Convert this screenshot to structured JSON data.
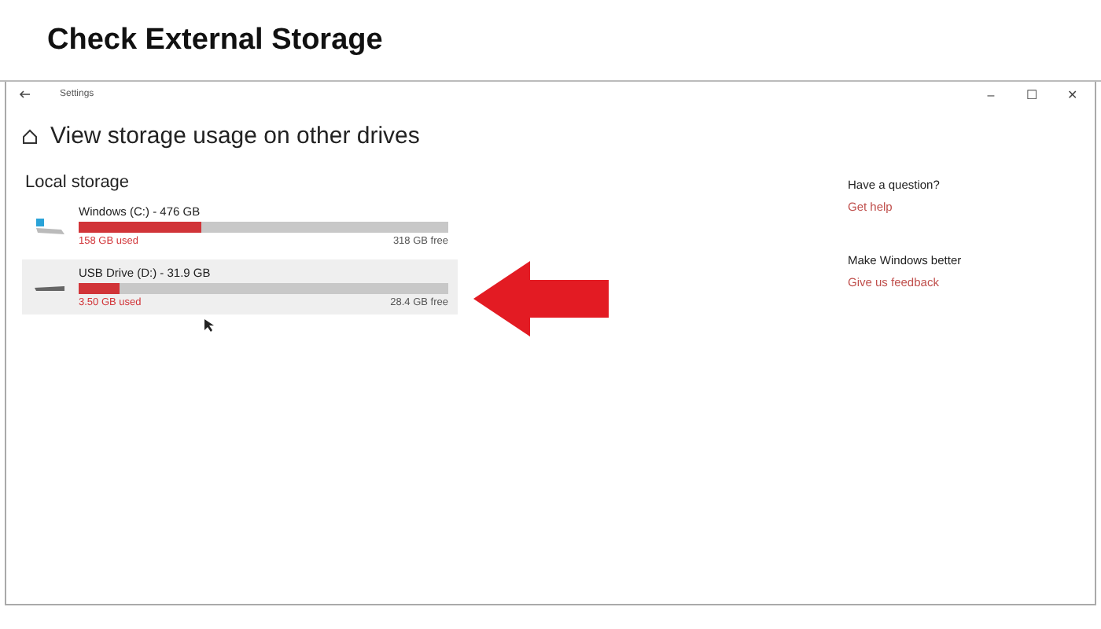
{
  "banner": {
    "title": "Check External Storage"
  },
  "window": {
    "title": "Settings",
    "controls": [
      "–",
      "☐",
      "✕"
    ]
  },
  "page": {
    "heading": "View storage usage on other drives",
    "section": "Local storage"
  },
  "drives": [
    {
      "name": "Windows (C:) - 476 GB",
      "kind": "system",
      "used": "158 GB used",
      "free": "318 GB free",
      "level": 0.33,
      "selected": false
    },
    {
      "name": "USB Drive (D:) - 31.9 GB",
      "kind": "usb",
      "used": "3.50 GB used",
      "free": "28.4 GB free",
      "level": 0.11,
      "selected": true
    }
  ],
  "side": [
    {
      "title": "Have a question?",
      "link": "Get help"
    },
    {
      "title": "Make Windows better",
      "link": "Give us feedback"
    }
  ]
}
